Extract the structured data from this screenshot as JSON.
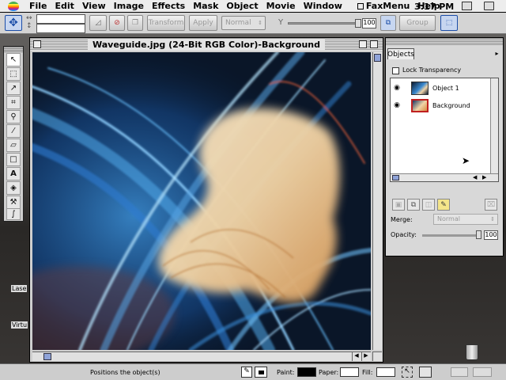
{
  "menubar": {
    "items": [
      "File",
      "Edit",
      "View",
      "Image",
      "Effects",
      "Mask",
      "Object",
      "Movie",
      "Window",
      "FaxMenu",
      "Help"
    ],
    "clock": "3:17 PM"
  },
  "propbar": {
    "transform_label": "Transform",
    "apply_label": "Apply",
    "merge_select": "Normal",
    "opacity_value": "100",
    "group_label": "Group"
  },
  "toolbox": {
    "tools": [
      "move-tool-icon",
      "marquee-tool-icon",
      "lasso-tool-icon",
      "crop-tool-icon",
      "zoom-tool-icon",
      "eyedropper-tool-icon",
      "eraser-tool-icon",
      "rectangle-tool-icon",
      "text-tool-icon",
      "fill-tool-icon",
      "clone-tool-icon",
      "brush-tool-icon"
    ]
  },
  "document": {
    "title": "Waveguide.jpg (24-Bit RGB Color)-Background"
  },
  "objects_panel": {
    "tab_label": "Objects",
    "lock_transparency_label": "Lock Transparency",
    "layers": [
      {
        "name": "Object 1",
        "selected": false
      },
      {
        "name": "Background",
        "selected": true
      }
    ],
    "merge_label": "Merge:",
    "merge_value": "Normal",
    "opacity_label": "Opacity:",
    "opacity_value": "100"
  },
  "desktop": {
    "labels": [
      "Lase",
      "Virtu"
    ]
  },
  "statusbar": {
    "message": "Positions the object(s)",
    "paint_label": "Paint:",
    "paper_label": "Paper:",
    "fill_label": "Fill:"
  },
  "colors": {
    "paint": "#000000",
    "paper": "#ffffff",
    "fill": "#ffffff",
    "selection_accent": "#c02020"
  }
}
